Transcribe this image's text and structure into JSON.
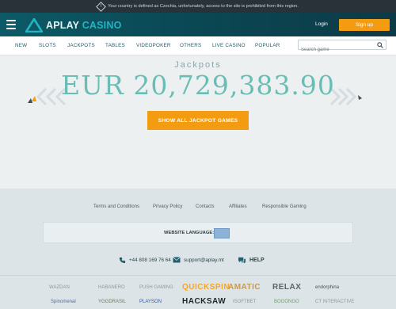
{
  "banner": {
    "icon": "warning-diamond-icon",
    "text": "Your country is defined as Czechia, unfortunately, access to the site is prohibited from this region."
  },
  "header": {
    "brand_part1": "APLAY",
    "brand_part2": "CASINO",
    "login_label": "Login",
    "signup_label": "Sign up",
    "accent_color": "#f39c12",
    "brand_color": "#1fb5c4"
  },
  "nav": {
    "items": [
      "NEW",
      "SLOTS",
      "JACKPOTS",
      "TABLES",
      "VIDEOPOKER",
      "OTHERS",
      "LIVE CASINO",
      "POPULAR"
    ],
    "search_placeholder": "Search game"
  },
  "hero": {
    "title": "Jackpots",
    "amount": "EUR 20,729,383.90",
    "button_label": "SHOW ALL JACKPOT GAMES"
  },
  "footer": {
    "links": [
      "Terms and Conditions",
      "Privacy Policy",
      "Contacts",
      "Affiliates",
      "Responsible Gaming"
    ],
    "language_label": "WEBSITE LANGUAGE:",
    "phone": "+44 808 169 76 64",
    "email": "support@aplay.mt",
    "help_label": "HELP",
    "providers_row1": [
      "WAZDAN",
      "HABANERO",
      "PUSH GAMING",
      "QUICKSPIN",
      "AMATIC",
      "RELAX",
      "endorphina"
    ],
    "providers_row2": [
      "Spinomenal",
      "YGGDRASIL",
      "PLAYSON",
      "HACKSAW",
      "ISOFTBET",
      "BOOONGO",
      "CT INTERACTIVE"
    ]
  }
}
